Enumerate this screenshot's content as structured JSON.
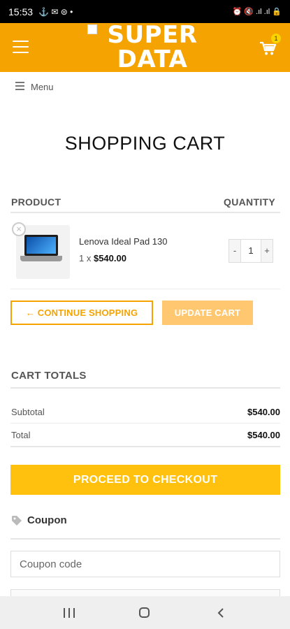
{
  "status_bar": {
    "time": "15:53",
    "left_icons": "⚓ ✉ ⊜ •",
    "right_icons": "⏰ 🔇 .ıl .ıl 🔒"
  },
  "header": {
    "logo_line1": "SUPER",
    "logo_line2": "DATA",
    "cart_count": "1",
    "brand_color": "#f5a300"
  },
  "menu": {
    "label": "Menu"
  },
  "page": {
    "title": "SHOPPING CART"
  },
  "cart_table": {
    "col_product": "PRODUCT",
    "col_quantity": "QUANTITY",
    "items": [
      {
        "name": "Lenova Ideal Pad 130",
        "qty_prefix": "1 x",
        "price": "$540.00",
        "quantity": "1"
      }
    ]
  },
  "buttons": {
    "continue_shopping": "← CONTINUE SHOPPING",
    "update_cart": "UPDATE CART",
    "checkout": "PROCEED TO CHECKOUT",
    "qty_minus": "-",
    "qty_plus": "+",
    "remove": "×"
  },
  "cart_totals": {
    "title": "CART TOTALS",
    "subtotal_label": "Subtotal",
    "subtotal_value": "$540.00",
    "total_label": "Total",
    "total_value": "$540.00"
  },
  "coupon": {
    "title": "Coupon",
    "placeholder": "Coupon code"
  }
}
